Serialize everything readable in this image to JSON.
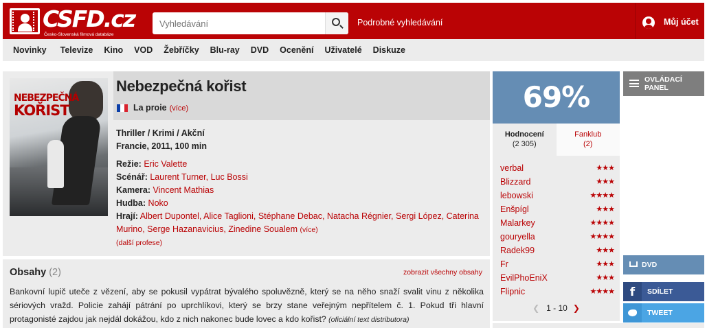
{
  "header": {
    "logo_text": "CSFD.cz",
    "logo_tagline": "Česko-Slovenská filmová databáze",
    "search_placeholder": "Vyhledávání",
    "advanced_search": "Podrobné vyhledávání",
    "account": "Můj účet"
  },
  "nav": [
    "Novinky",
    "Televize",
    "Kino",
    "VOD",
    "Žebříčky",
    "Blu-ray",
    "DVD",
    "Ocenění",
    "Uživatelé",
    "Diskuze"
  ],
  "film": {
    "title": "Nebezpečná kořist",
    "original_title": "La proie",
    "original_more": "(více)",
    "flag_colors": [
      "#0b3ea8",
      "#ffffff",
      "#d9232e"
    ],
    "poster_title_line1": "NEBEZPEČNÁ",
    "poster_title_line2": "KOŘIST",
    "genres": "Thriller / Krimi / Akční",
    "origin": "Francie, 2011, 100 min",
    "director_label": "Režie:",
    "director": "Eric Valette",
    "writers_label": "Scénář:",
    "writers": "Laurent Turner, Luc Bossi",
    "camera_label": "Kamera:",
    "camera": "Vincent Mathias",
    "music_label": "Hudba:",
    "music": "Noko",
    "cast_label": "Hrají:",
    "cast": "Albert Dupontel, Alice Taglioni, Stéphane Debac, Natacha Régnier, Sergi López, Caterina Murino, Serge Hazanavicius, Zinedine Soualem",
    "cast_more": "(více)",
    "other_professions": "(další profese)"
  },
  "plot": {
    "heading": "Obsahy",
    "count": "(2)",
    "show_all": "zobrazit všechny obsahy",
    "text": "Bankovní lupič uteče z vězení, aby se pokusil vypátrat bývalého spoluvězně, který se na něho snaží svalit vinu z několika sériových vražd. Policie zahájí pátrání po uprchlíkovi, který se brzy stane veřejným nepřítelem č. 1. Pokud tři hlavní protagonisté zajdou jak nejdál dokážou, kdo z nich nakonec bude lovec a kdo kořist?",
    "source": "(oficiální text distributora)"
  },
  "rating": {
    "percent": "69%",
    "tab_ratings": "Hodnocení",
    "tab_ratings_count": "(2 305)",
    "tab_fanclub": "Fanklub",
    "tab_fanclub_count": "(2)",
    "users": [
      {
        "name": "verbal",
        "stars": "★★★"
      },
      {
        "name": "Blizzard",
        "stars": "★★★"
      },
      {
        "name": "lebowski",
        "stars": "★★★★"
      },
      {
        "name": "Enšpígl",
        "stars": "★★★"
      },
      {
        "name": "Malarkey",
        "stars": "★★★★"
      },
      {
        "name": "gouryella",
        "stars": "★★★★"
      },
      {
        "name": "Radek99",
        "stars": "★★★"
      },
      {
        "name": "Fr",
        "stars": "★★★"
      },
      {
        "name": "EvilPhoEniX",
        "stars": "★★★"
      },
      {
        "name": "Flipnic",
        "stars": "★★★★"
      }
    ],
    "pager": "1 - 10"
  },
  "side": {
    "control_panel": "OVLÁDACÍ PANEL",
    "dvd": "DVD",
    "share": "SDÍLET",
    "tweet": "TWEET"
  },
  "colors": {
    "brand_red": "#ba0305",
    "rating_blue": "#658db4",
    "facebook": "#3b5a96",
    "twitter": "#4ba5e4"
  }
}
